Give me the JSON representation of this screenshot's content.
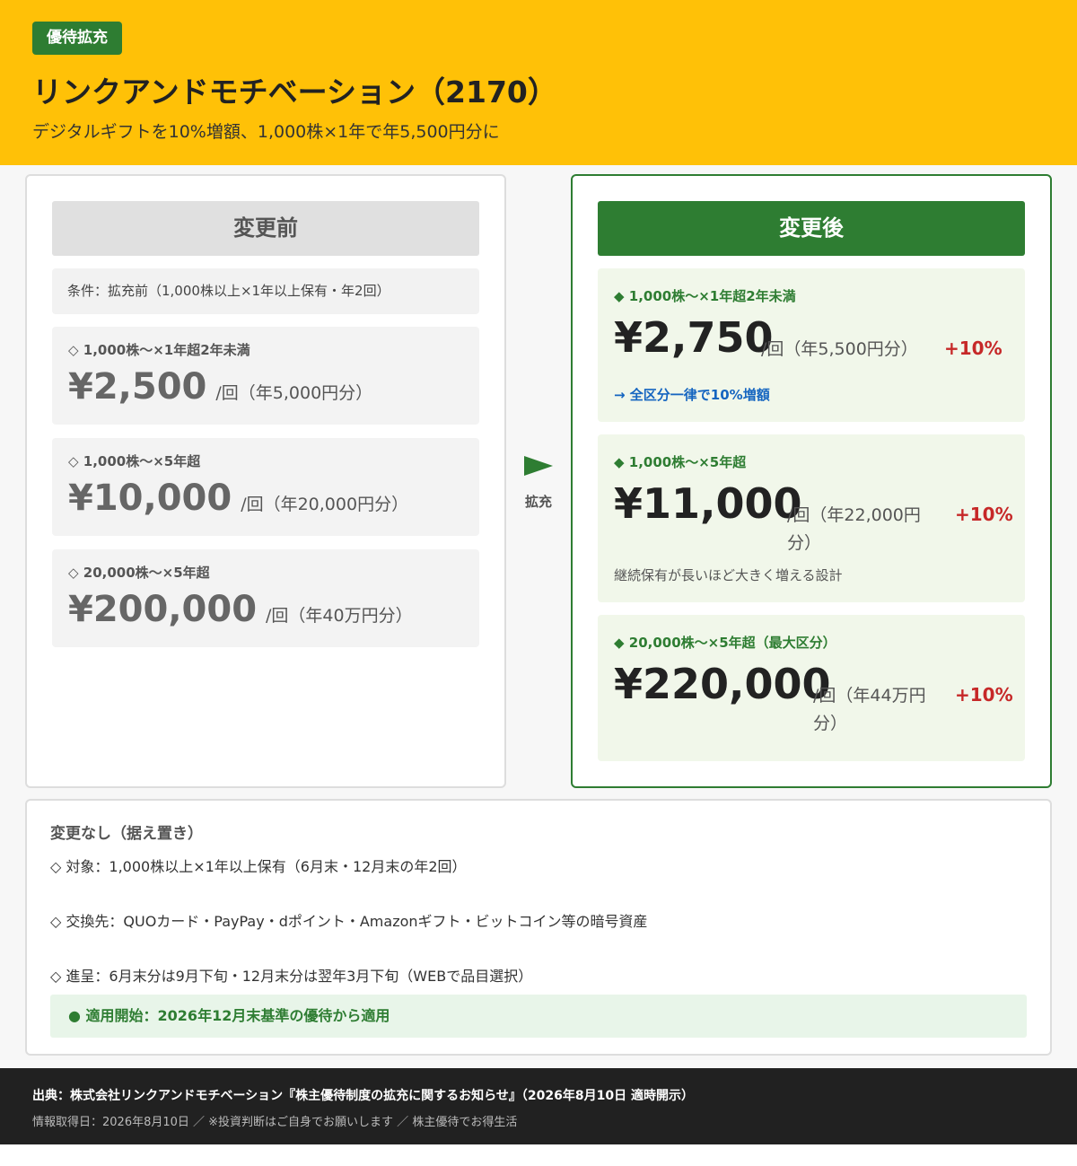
{
  "header": {
    "badge": "優待拡充",
    "title": "リンクアンドモチベーション（2170）",
    "subtitle": "デジタルギフトを10%増額、1,000株×1年で年5,500円分に"
  },
  "before": {
    "heading": "変更前",
    "condition": "条件：拡充前（1,000株以上×1年以上保有・年2回）",
    "tiers": [
      {
        "label": "◇ 1,000株〜×1年超2年未満",
        "price": "¥2,500",
        "unit": "/回（年5,000円分）"
      },
      {
        "label": "◇ 1,000株〜×5年超",
        "price": "¥10,000",
        "unit": "/回（年20,000円分）"
      },
      {
        "label": "◇ 20,000株〜×5年超",
        "price": "¥200,000",
        "unit": "/回（年40万円分）"
      }
    ]
  },
  "arrow": {
    "label": "拡充",
    "color": "#2E7D32"
  },
  "after": {
    "heading": "変更後",
    "tiers": [
      {
        "label": "◆ 1,000株〜×1年超2年未満",
        "price": "¥2,750",
        "unit": "/回（年5,500円分）",
        "pct": "+10%",
        "note": "→ 全区分一律で10%増額"
      },
      {
        "label": "◆ 1,000株〜×5年超",
        "price": "¥11,000",
        "unit": "/回（年22,000円分）",
        "pct": "+10%",
        "note": "継続保有が長いほど大きく増える設計"
      },
      {
        "label": "◆ 20,000株〜×5年超（最大区分）",
        "price": "¥220,000",
        "unit": "/回（年44万円分）",
        "pct": "+10%"
      }
    ]
  },
  "no_change": {
    "title": "変更なし（据え置き）",
    "items": [
      "◇ 対象：1,000株以上×1年以上保有（6月末・12月末の年2回）",
      "◇ 交換先：QUOカード・PayPay・dポイント・Amazonギフト・ビットコイン等の暗号資産",
      "◇ 進呈：6月末分は9月下旬・12月末分は翌年3月下旬（WEBで品目選択）"
    ],
    "start": "● 適用開始：2026年12月末基準の優待から適用"
  },
  "footer": {
    "source": "出典：株式会社リンクアンドモチベーション『株主優待制度の拡充に関するお知らせ』（2026年8月10日 適時開示）",
    "info": "情報取得日：2026年8月10日 ／ ※投資判断はご自身でお願いします ／ 株主優待でお得生活"
  },
  "colors": {
    "header_bg": "#FFC107",
    "accent_green": "#2E7D32",
    "increase_red": "#C62828",
    "footer_bg": "#212121"
  }
}
